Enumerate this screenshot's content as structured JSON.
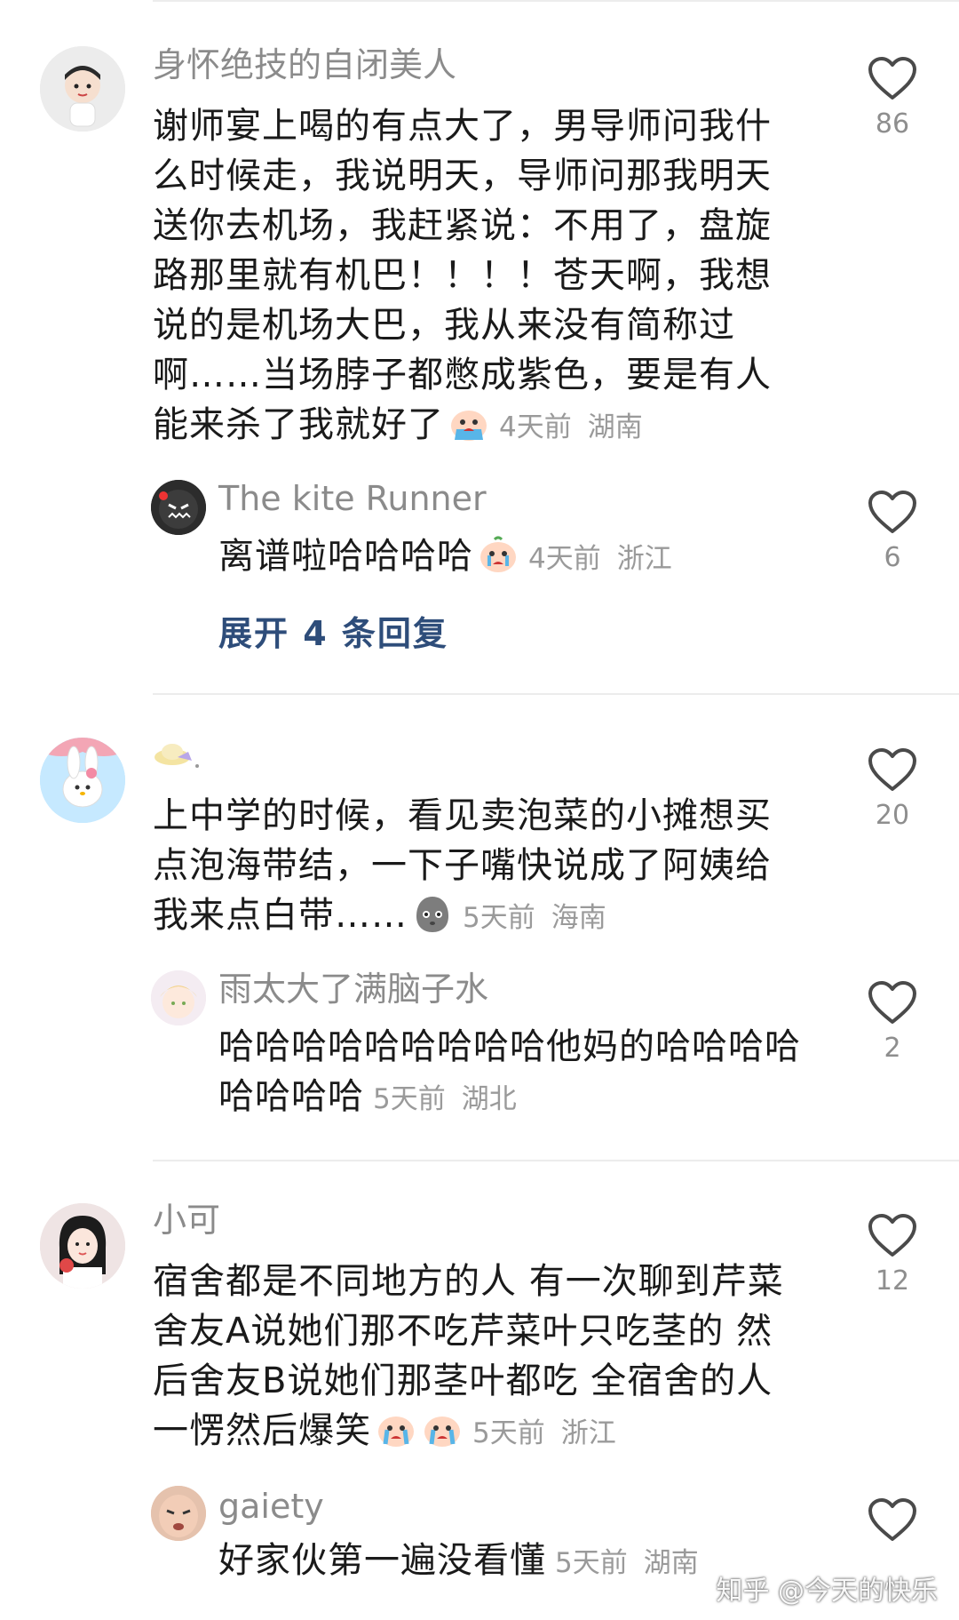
{
  "comments": [
    {
      "username": "身怀绝技的自闭美人",
      "text": "谢师宴上喝的有点大了，男导师问我什么时候走，我说明天，导师问那我明天送你去机场，我赶紧说：不用了，盘旋路那里就有机巴！！！！苍天啊，我想说的是机场大巴，我从来没有简称过啊……当场脖子都憋成紫色，要是有人能来杀了我就好了",
      "time": "4天前",
      "location": "湖南",
      "likes": "86",
      "reply": {
        "username": "The kite Runner",
        "text": "离谱啦哈哈哈哈",
        "time": "4天前",
        "location": "浙江",
        "likes": "6"
      },
      "expand": "展开 4 条回复"
    },
    {
      "username": "",
      "text": "上中学的时候，看见卖泡菜的小摊想买点泡海带结，一下子嘴快说成了阿姨给我来点白带……",
      "time": "5天前",
      "location": "海南",
      "likes": "20",
      "reply": {
        "username": "雨太大了满脑子水",
        "text": "哈哈哈哈哈哈哈哈哈他妈的哈哈哈哈哈哈哈哈",
        "time": "5天前",
        "location": "湖北",
        "likes": "2"
      }
    },
    {
      "username": "小可",
      "text": "宿舍都是不同地方的人 有一次聊到芹菜 舍友A说她们那不吃芹菜叶只吃茎的 然后舍友B说她们那茎叶都吃 全宿舍的人一愣然后爆笑",
      "time": "5天前",
      "location": "浙江",
      "likes": "12",
      "reply": {
        "username": "gaiety",
        "text": "好家伙第一遍没看懂",
        "time": "5天前",
        "location": "湖南",
        "likes": ""
      }
    }
  ],
  "watermark": "知乎 @今天的快乐",
  "icons": {
    "like": "heart-outline-icon",
    "emoji_cry": "crying-face-emoji-icon",
    "emoji_dumb": "blank-face-emoji-icon",
    "watermark": "zhihu-logo-icon"
  },
  "colors": {
    "username": "#8b8b8b",
    "meta": "#9a9a9a",
    "expand_link": "#2e4d7a",
    "divider": "#ececec"
  }
}
